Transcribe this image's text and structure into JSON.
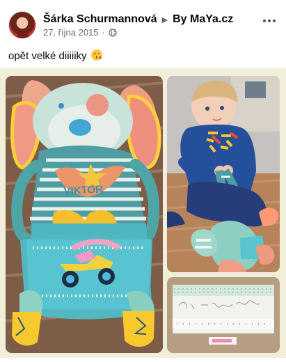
{
  "post": {
    "author_name": "Šárka Schurmannová",
    "separator_icon": "triangle-right-icon",
    "target_page": "By MaYa.cz",
    "date": "27. října 2015",
    "meta_dot": "·",
    "privacy_icon": "globe-icon",
    "more_icon": "more-dots-icon",
    "text": "opět velké diiiiiky",
    "emoji": "kissing-face-heart-emoji"
  },
  "photos": [
    {
      "name": "photo-plush-dog-toy",
      "description_icon": "plush-toy"
    },
    {
      "name": "photo-boy-with-toy",
      "description_icon": "child"
    },
    {
      "name": "photo-card",
      "description_icon": "card"
    }
  ],
  "colors": {
    "name": "#050505",
    "secondary_text": "#65676b",
    "photo_background": "#f1efd9"
  }
}
